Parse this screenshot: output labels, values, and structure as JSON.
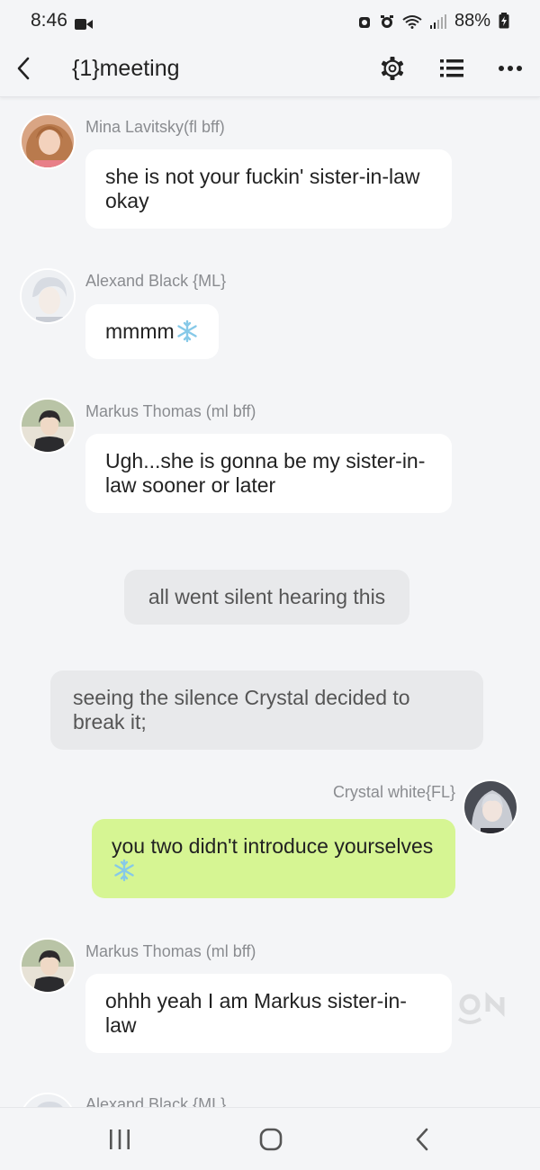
{
  "status_bar": {
    "time": "8:46",
    "battery": "88%"
  },
  "header": {
    "title": "{1}meeting"
  },
  "messages": [
    {
      "sender": "Mina Lavitsky(fl bff)",
      "text": "she is not your fuckin' sister-in-law okay"
    },
    {
      "sender": "Alexand Black {ML}",
      "text": "mmmm"
    },
    {
      "sender": "Markus Thomas  (ml bff)",
      "text": "Ugh...she is gonna be my sister-in-law sooner or later"
    },
    {
      "narration": "all went silent hearing this"
    },
    {
      "narration": "seeing the silence Crystal decided to break it;"
    },
    {
      "sender": "Crystal white{FL}",
      "text": "you two didn't introduce yourselves"
    },
    {
      "sender": "Markus Thomas  (ml bff)",
      "text": "ohhh yeah I am Markus sister-in-law"
    },
    {
      "sender": "Alexand Black {ML}"
    }
  ],
  "colors": {
    "background": "#f4f5f7",
    "own_bubble": "#d6f593",
    "other_bubble": "#ffffff",
    "narration_bubble": "#e8e9eb"
  },
  "icons": [
    "back-icon",
    "gear-icon",
    "list-icon",
    "more-icon",
    "snowflake-emoji",
    "recents-icon",
    "home-icon",
    "nav-back-icon"
  ]
}
